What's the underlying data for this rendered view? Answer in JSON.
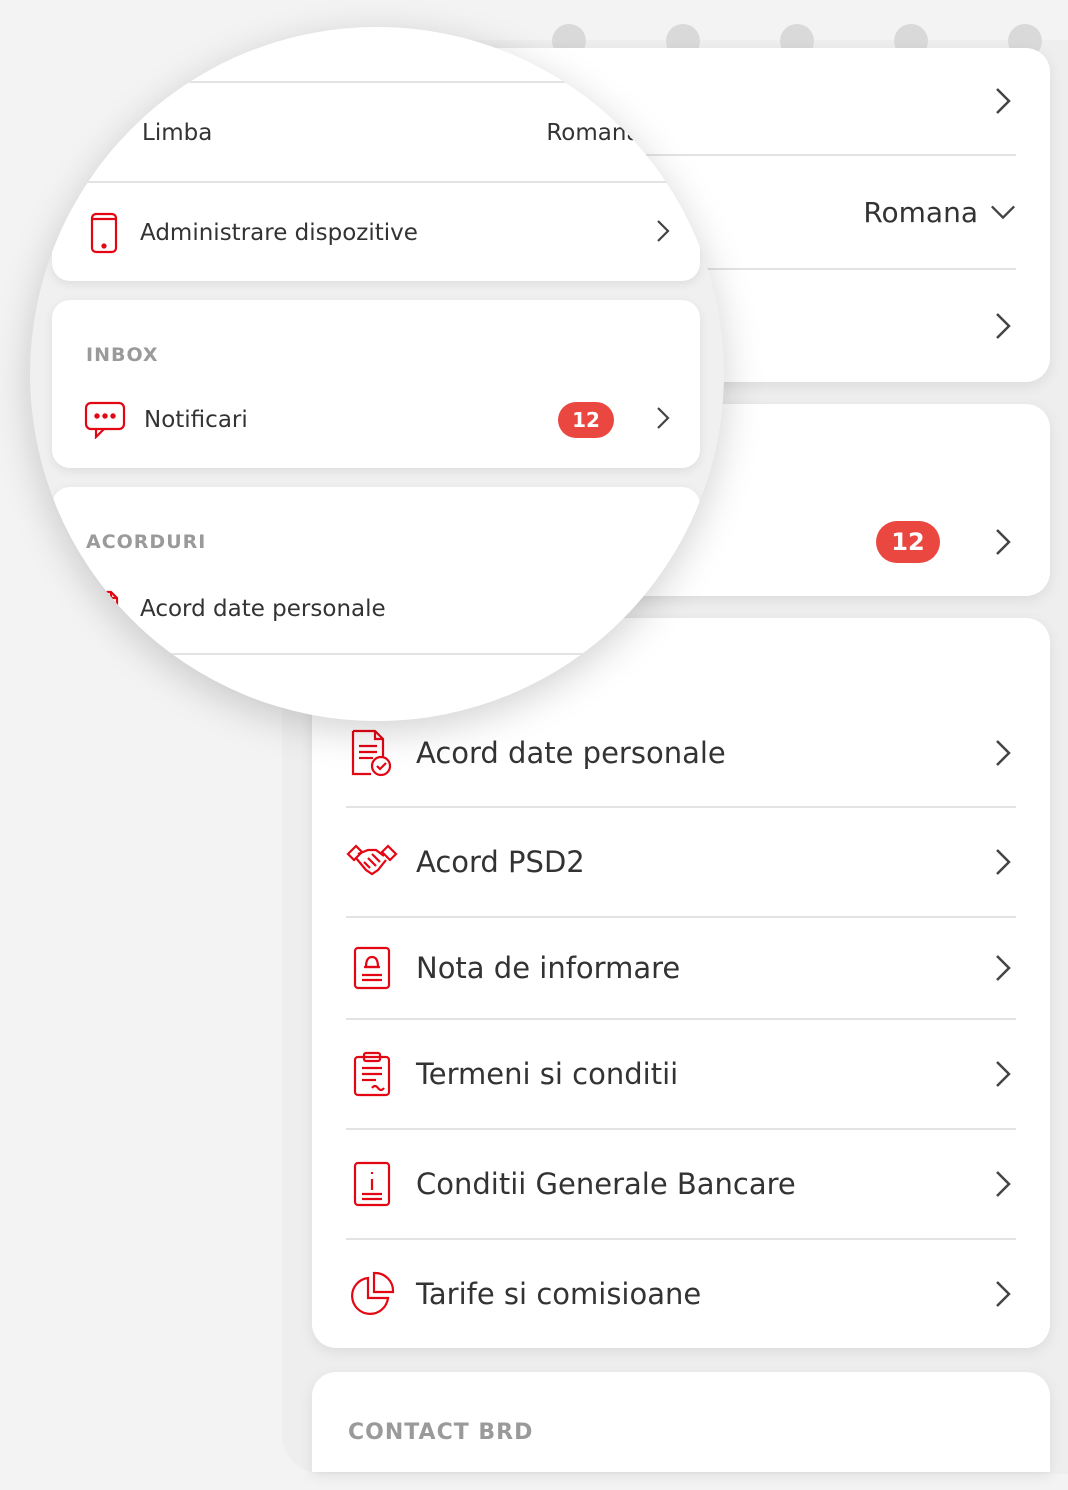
{
  "settings": {
    "language_value": "Romana",
    "language_label": "Limba",
    "devices_label": "Administrare dispozitive"
  },
  "inbox": {
    "section_title": "INBOX",
    "notifications_label": "Notificari",
    "notifications_count": "12"
  },
  "agreements": {
    "section_title": "ACORDURI",
    "items": [
      {
        "label": "Acord date personale",
        "icon": "document-check-icon"
      },
      {
        "label": "Acord PSD2",
        "icon": "handshake-icon"
      },
      {
        "label": "Nota de informare",
        "icon": "bell-document-icon"
      },
      {
        "label": "Termeni si conditii",
        "icon": "clipboard-icon"
      },
      {
        "label": "Conditii Generale Bancare",
        "icon": "info-document-icon"
      },
      {
        "label": "Tarife si comisioane",
        "icon": "pie-chart-icon"
      }
    ]
  },
  "contact": {
    "section_title": "CONTACT BRD"
  },
  "colors": {
    "accent": "#e9473f",
    "icon_red": "#e30613"
  }
}
